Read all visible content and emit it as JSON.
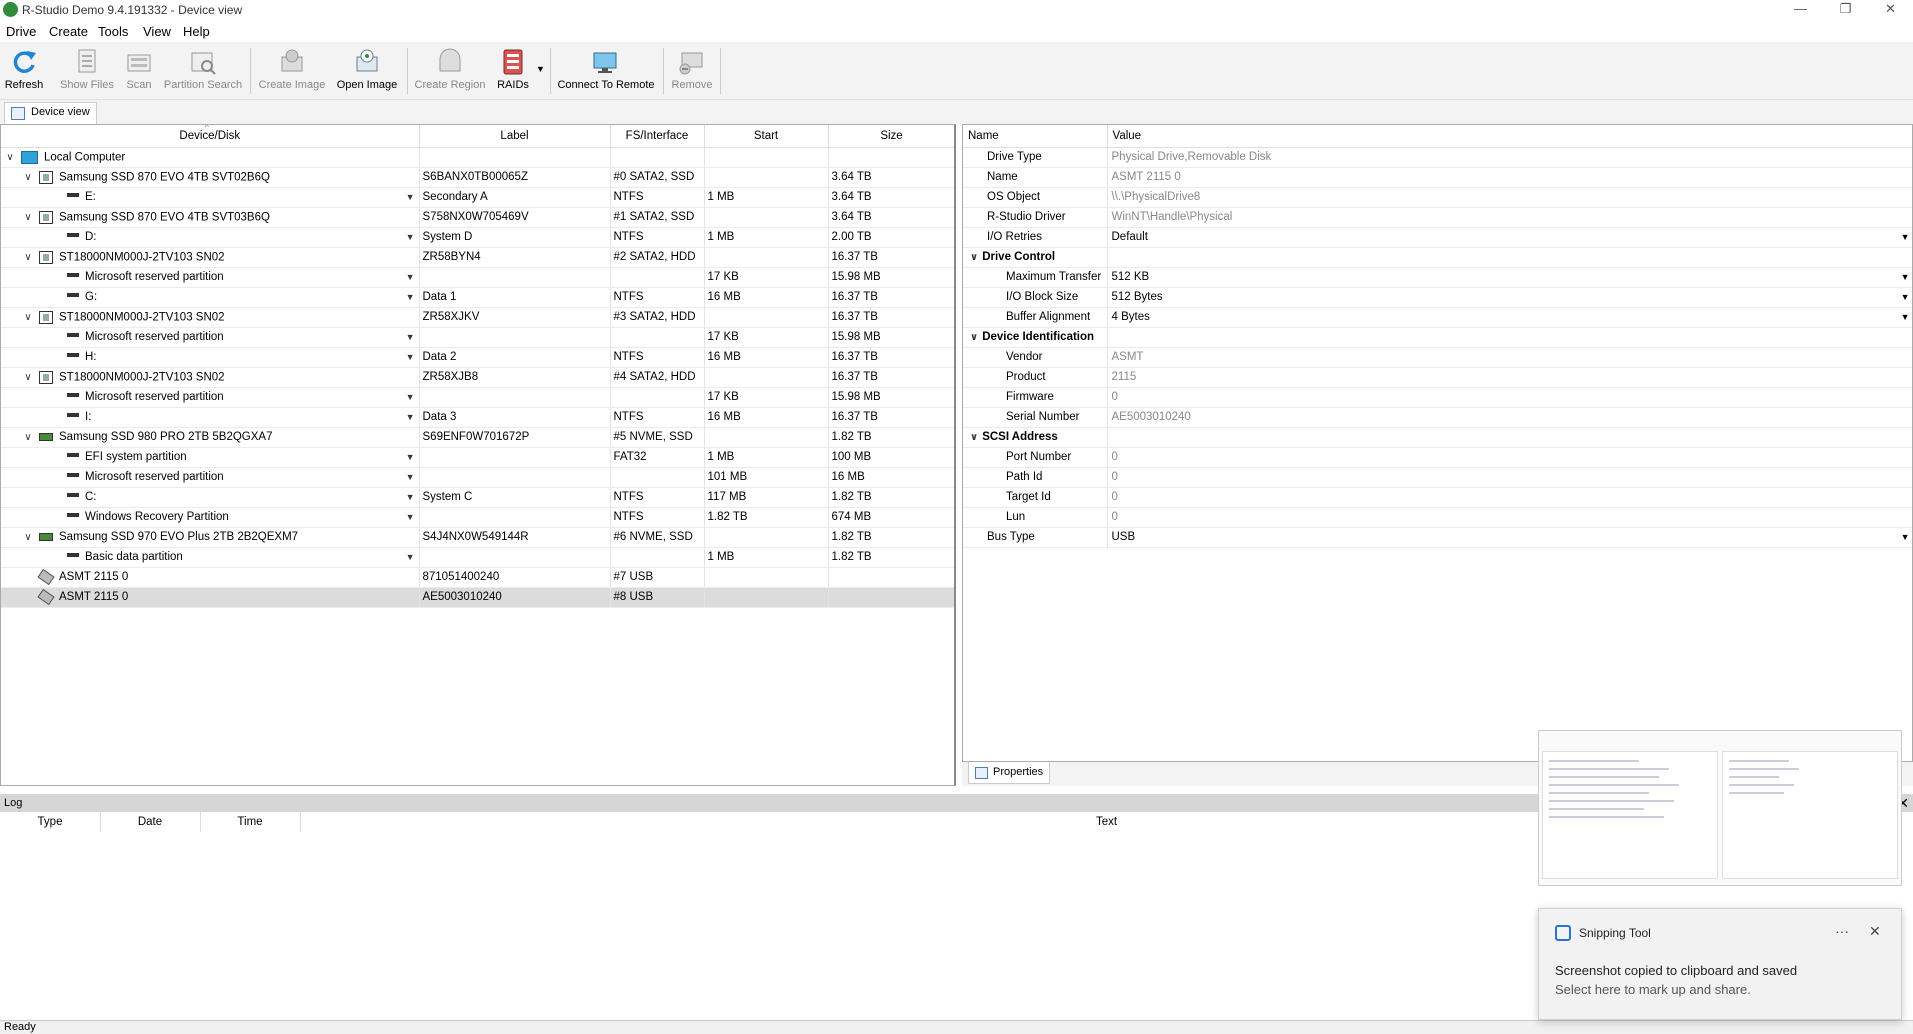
{
  "window": {
    "title": "R-Studio Demo 9.4.191332 - Device view"
  },
  "menu": [
    "Drive",
    "Create",
    "Tools",
    "View",
    "Help"
  ],
  "toolbar": [
    {
      "label": "Refresh",
      "enabled": true
    },
    {
      "label": "Show Files",
      "enabled": false
    },
    {
      "label": "Scan",
      "enabled": false
    },
    {
      "label": "Partition Search",
      "enabled": false
    },
    {
      "label": "Create Image",
      "enabled": false
    },
    {
      "label": "Open Image",
      "enabled": true
    },
    {
      "label": "Create Region",
      "enabled": false
    },
    {
      "label": "RAIDs",
      "enabled": true
    },
    {
      "label": "Connect To Remote",
      "enabled": true
    },
    {
      "label": "Remove",
      "enabled": false
    }
  ],
  "tabs": {
    "device_view": "Device view",
    "properties": "Properties"
  },
  "devices": {
    "columns": [
      "Device/Disk",
      "Label",
      "FS/Interface",
      "Start",
      "Size"
    ],
    "rows": [
      {
        "name": "Local Computer",
        "label": "",
        "fs": "",
        "start": "",
        "size": "",
        "level": 0,
        "icon": "computer",
        "expand": true,
        "dd": false
      },
      {
        "name": "Samsung SSD 870 EVO 4TB SVT02B6Q",
        "label": "S6BANX0TB00065Z",
        "fs": "#0 SATA2, SSD",
        "start": "",
        "size": "3.64 TB",
        "level": 1,
        "icon": "hdd",
        "expand": true,
        "dd": false
      },
      {
        "name": "E:",
        "label": "Secondary A",
        "fs": "NTFS",
        "start": "1 MB",
        "size": "3.64 TB",
        "level": 2,
        "icon": "partition",
        "expand": false,
        "dd": true
      },
      {
        "name": "Samsung SSD 870 EVO 4TB SVT03B6Q",
        "label": "S758NX0W705469V",
        "fs": "#1 SATA2, SSD",
        "start": "",
        "size": "3.64 TB",
        "level": 1,
        "icon": "hdd",
        "expand": true,
        "dd": false
      },
      {
        "name": "D:",
        "label": "System D",
        "fs": "NTFS",
        "start": "1 MB",
        "size": "2.00 TB",
        "level": 2,
        "icon": "partition",
        "expand": false,
        "dd": true
      },
      {
        "name": "ST18000NM000J-2TV103 SN02",
        "label": "ZR58BYN4",
        "fs": "#2 SATA2, HDD",
        "start": "",
        "size": "16.37 TB",
        "level": 1,
        "icon": "hdd",
        "expand": true,
        "dd": false
      },
      {
        "name": "Microsoft reserved partition",
        "label": "",
        "fs": "",
        "start": "17 KB",
        "size": "15.98 MB",
        "level": 2,
        "icon": "partition",
        "expand": false,
        "dd": true
      },
      {
        "name": "G:",
        "label": "Data 1",
        "fs": "NTFS",
        "start": "16 MB",
        "size": "16.37 TB",
        "level": 2,
        "icon": "partition",
        "expand": false,
        "dd": true
      },
      {
        "name": "ST18000NM000J-2TV103 SN02",
        "label": "ZR58XJKV",
        "fs": "#3 SATA2, HDD",
        "start": "",
        "size": "16.37 TB",
        "level": 1,
        "icon": "hdd",
        "expand": true,
        "dd": false
      },
      {
        "name": "Microsoft reserved partition",
        "label": "",
        "fs": "",
        "start": "17 KB",
        "size": "15.98 MB",
        "level": 2,
        "icon": "partition",
        "expand": false,
        "dd": true
      },
      {
        "name": "H:",
        "label": "Data 2",
        "fs": "NTFS",
        "start": "16 MB",
        "size": "16.37 TB",
        "level": 2,
        "icon": "partition",
        "expand": false,
        "dd": true
      },
      {
        "name": "ST18000NM000J-2TV103 SN02",
        "label": "ZR58XJB8",
        "fs": "#4 SATA2, HDD",
        "start": "",
        "size": "16.37 TB",
        "level": 1,
        "icon": "hdd",
        "expand": true,
        "dd": false
      },
      {
        "name": "Microsoft reserved partition",
        "label": "",
        "fs": "",
        "start": "17 KB",
        "size": "15.98 MB",
        "level": 2,
        "icon": "partition",
        "expand": false,
        "dd": true
      },
      {
        "name": "I:",
        "label": "Data 3",
        "fs": "NTFS",
        "start": "16 MB",
        "size": "16.37 TB",
        "level": 2,
        "icon": "partition",
        "expand": false,
        "dd": true
      },
      {
        "name": "Samsung SSD 980 PRO 2TB 5B2QGXA7",
        "label": "S69ENF0W701672P",
        "fs": "#5 NVME, SSD",
        "start": "",
        "size": "1.82 TB",
        "level": 1,
        "icon": "nvme",
        "expand": true,
        "dd": false
      },
      {
        "name": "EFI system partition",
        "label": "",
        "fs": "FAT32",
        "start": "1 MB",
        "size": "100 MB",
        "level": 2,
        "icon": "partition",
        "expand": false,
        "dd": true
      },
      {
        "name": "Microsoft reserved partition",
        "label": "",
        "fs": "",
        "start": "101 MB",
        "size": "16 MB",
        "level": 2,
        "icon": "partition",
        "expand": false,
        "dd": true
      },
      {
        "name": "C:",
        "label": "System C",
        "fs": "NTFS",
        "start": "117 MB",
        "size": "1.82 TB",
        "level": 2,
        "icon": "partition",
        "expand": false,
        "dd": true
      },
      {
        "name": "Windows Recovery Partition",
        "label": "",
        "fs": "NTFS",
        "start": "1.82 TB",
        "size": "674 MB",
        "level": 2,
        "icon": "partition",
        "expand": false,
        "dd": true
      },
      {
        "name": "Samsung SSD 970 EVO Plus 2TB 2B2QEXM7",
        "label": "S4J4NX0W549144R",
        "fs": "#6 NVME, SSD",
        "start": "",
        "size": "1.82 TB",
        "level": 1,
        "icon": "nvme",
        "expand": true,
        "dd": false
      },
      {
        "name": "Basic data partition",
        "label": "",
        "fs": "",
        "start": "1 MB",
        "size": "1.82 TB",
        "level": 2,
        "icon": "partition",
        "expand": false,
        "dd": true
      },
      {
        "name": "ASMT 2115 0",
        "label": "871051400240",
        "fs": "#7 USB",
        "start": "",
        "size": "",
        "level": 1,
        "icon": "usb",
        "expand": false,
        "dd": false
      },
      {
        "name": "ASMT 2115 0",
        "label": "AE5003010240",
        "fs": "#8 USB",
        "start": "",
        "size": "",
        "level": 1,
        "icon": "usb",
        "expand": false,
        "dd": false,
        "selected": true
      }
    ]
  },
  "properties": {
    "columns": [
      "Name",
      "Value"
    ],
    "rows": [
      {
        "name": "Drive Type",
        "value": "Physical Drive,Removable Disk",
        "kind": "item",
        "gray": true,
        "dd": false
      },
      {
        "name": "Name",
        "value": "ASMT 2115 0",
        "kind": "item",
        "gray": true,
        "dd": false
      },
      {
        "name": "OS Object",
        "value": "\\\\.\\PhysicalDrive8",
        "kind": "item",
        "gray": true,
        "dd": false
      },
      {
        "name": "R-Studio Driver",
        "value": "WinNT\\Handle\\Physical",
        "kind": "item",
        "gray": true,
        "dd": false
      },
      {
        "name": "I/O Retries",
        "value": "Default",
        "kind": "item",
        "gray": false,
        "dd": true
      },
      {
        "name": "Drive Control",
        "value": "",
        "kind": "group",
        "gray": false,
        "dd": false
      },
      {
        "name": "Maximum Transfer",
        "value": "512 KB",
        "kind": "sub",
        "gray": false,
        "dd": true
      },
      {
        "name": "I/O Block Size",
        "value": "512 Bytes",
        "kind": "sub",
        "gray": false,
        "dd": true
      },
      {
        "name": "Buffer Alignment",
        "value": "4 Bytes",
        "kind": "sub",
        "gray": false,
        "dd": true
      },
      {
        "name": "Device Identification",
        "value": "",
        "kind": "group",
        "gray": false,
        "dd": false
      },
      {
        "name": "Vendor",
        "value": "ASMT",
        "kind": "sub",
        "gray": true,
        "dd": false
      },
      {
        "name": "Product",
        "value": "2115",
        "kind": "sub",
        "gray": true,
        "dd": false
      },
      {
        "name": "Firmware",
        "value": "0",
        "kind": "sub",
        "gray": true,
        "dd": false
      },
      {
        "name": "Serial Number",
        "value": "AE5003010240",
        "kind": "sub",
        "gray": true,
        "dd": false
      },
      {
        "name": "SCSI Address",
        "value": "",
        "kind": "group",
        "gray": false,
        "dd": false
      },
      {
        "name": "Port Number",
        "value": "0",
        "kind": "sub",
        "gray": true,
        "dd": false
      },
      {
        "name": "Path Id",
        "value": "0",
        "kind": "sub",
        "gray": true,
        "dd": false
      },
      {
        "name": "Target Id",
        "value": "0",
        "kind": "sub",
        "gray": true,
        "dd": false
      },
      {
        "name": "Lun",
        "value": "0",
        "kind": "sub",
        "gray": true,
        "dd": false
      },
      {
        "name": "Bus Type",
        "value": "USB",
        "kind": "item",
        "gray": false,
        "dd": true
      }
    ]
  },
  "log": {
    "title": "Log",
    "columns": [
      "Type",
      "Date",
      "Time",
      "Text"
    ]
  },
  "status": "Ready",
  "toast": {
    "app": "Snipping Tool",
    "line1": "Screenshot copied to clipboard and saved",
    "line2": "Select here to mark up and share."
  }
}
